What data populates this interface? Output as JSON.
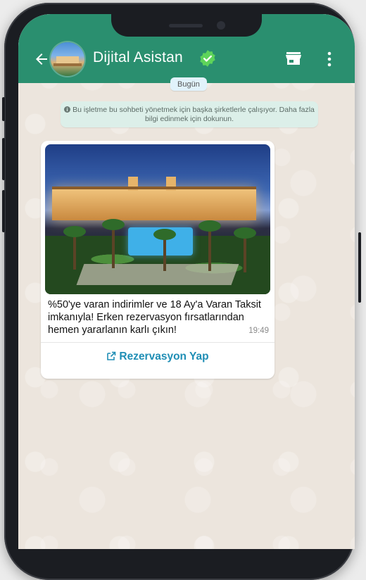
{
  "header": {
    "contact_name": "Dijital Asistan",
    "colors": {
      "bar": "#2a8f6f",
      "verified": "#5ed45a"
    }
  },
  "chat": {
    "date_label": "Bugün",
    "business_notice": "Bu işletme bu sohbeti yönetmek için başka şirketlerle çalışıyor. Daha fazla bilgi edinmek için dokunun.",
    "message": {
      "text": "%50'ye varan indirimler ve 18 Ay'a Varan Taksit imkanıyla! Erken rezervasyon fırsatlarından hemen yararlanın karlı çıkın!",
      "time": "19:49",
      "cta_label": "Rezervasyon Yap"
    }
  },
  "icons": [
    "back-arrow-icon",
    "verified-check-icon",
    "store-icon",
    "more-vert-icon",
    "info-icon",
    "external-link-icon"
  ]
}
